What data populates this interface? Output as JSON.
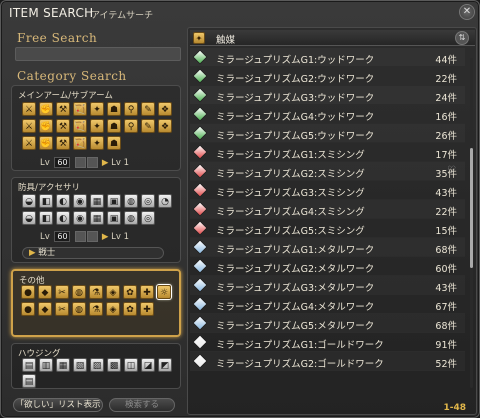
{
  "window": {
    "title_en": "ITEM SEARCH",
    "title_jp": "アイテムサーチ",
    "close_icon": "close-icon"
  },
  "free_search": {
    "heading": "Free Search",
    "value": "",
    "placeholder": ""
  },
  "category_search": {
    "heading": "Category Search",
    "groups": [
      {
        "label": "メインアーム/サブアーム",
        "level_min": "60",
        "level_max": "Lv 1",
        "lv_label": "Lv"
      },
      {
        "label": "防具/アクセサリ",
        "level_min": "60",
        "level_max": "Lv 1",
        "lv_label": "Lv",
        "job": "戦士"
      },
      {
        "label": "その他"
      },
      {
        "label": "ハウジング"
      }
    ]
  },
  "buttons": {
    "list_show": "「欲しい」リスト表示",
    "search": "検索する"
  },
  "results": {
    "category": "触媒",
    "sort_icon": "sort-icon",
    "rows": [
      {
        "name": "ミラージュプリズムG1:ウッドワーク",
        "count": "44件",
        "color": "#4caf50"
      },
      {
        "name": "ミラージュプリズムG2:ウッドワーク",
        "count": "22件",
        "color": "#4caf50"
      },
      {
        "name": "ミラージュプリズムG3:ウッドワーク",
        "count": "24件",
        "color": "#4caf50"
      },
      {
        "name": "ミラージュプリズムG4:ウッドワーク",
        "count": "16件",
        "color": "#4caf50"
      },
      {
        "name": "ミラージュプリズムG5:ウッドワーク",
        "count": "26件",
        "color": "#4caf50"
      },
      {
        "name": "ミラージュプリズムG1:スミシング",
        "count": "17件",
        "color": "#e04848"
      },
      {
        "name": "ミラージュプリズムG2:スミシング",
        "count": "35件",
        "color": "#e04848"
      },
      {
        "name": "ミラージュプリズムG3:スミシング",
        "count": "43件",
        "color": "#e04848"
      },
      {
        "name": "ミラージュプリズムG4:スミシング",
        "count": "22件",
        "color": "#e04848"
      },
      {
        "name": "ミラージュプリズムG5:スミシング",
        "count": "15件",
        "color": "#e04848"
      },
      {
        "name": "ミラージュプリズムG1:メタルワーク",
        "count": "68件",
        "color": "#8ab8e0"
      },
      {
        "name": "ミラージュプリズムG2:メタルワーク",
        "count": "60件",
        "color": "#8ab8e0"
      },
      {
        "name": "ミラージュプリズムG3:メタルワーク",
        "count": "43件",
        "color": "#8ab8e0"
      },
      {
        "name": "ミラージュプリズムG4:メタルワーク",
        "count": "67件",
        "color": "#8ab8e0"
      },
      {
        "name": "ミラージュプリズムG5:メタルワーク",
        "count": "68件",
        "color": "#8ab8e0"
      },
      {
        "name": "ミラージュプリズムG1:ゴールドワーク",
        "count": "91件",
        "color": "#e8e8e8"
      },
      {
        "name": "ミラージュプリズムG2:ゴールドワーク",
        "count": "52件",
        "color": "#e8e8e8"
      }
    ],
    "range": "1-48"
  }
}
